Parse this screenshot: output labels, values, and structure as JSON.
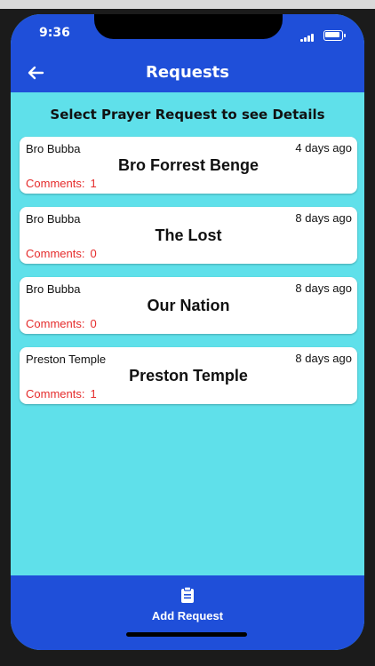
{
  "status_bar": {
    "time": "9:36"
  },
  "app_bar": {
    "title": "Requests",
    "back_icon": "arrow-left-icon"
  },
  "subtitle": "Select Prayer Request to see Details",
  "requests": [
    {
      "author": "Bro Bubba",
      "age": "4 days ago",
      "title": "Bro Forrest Benge",
      "comments_label": "Comments:",
      "comments_count": "1"
    },
    {
      "author": "Bro Bubba",
      "age": "8 days ago",
      "title": "The Lost",
      "comments_label": "Comments:",
      "comments_count": "0"
    },
    {
      "author": "Bro Bubba",
      "age": "8 days ago",
      "title": "Our Nation",
      "comments_label": "Comments:",
      "comments_count": "0"
    },
    {
      "author": "Preston Temple",
      "age": "8 days ago",
      "title": "Preston Temple",
      "comments_label": "Comments:",
      "comments_count": "1"
    }
  ],
  "bottom_bar": {
    "add_label": "Add Request",
    "add_icon": "clipboard-icon"
  },
  "colors": {
    "primary": "#1f4fd9",
    "background": "#5fe0ea",
    "comments": "#e52b2b"
  }
}
